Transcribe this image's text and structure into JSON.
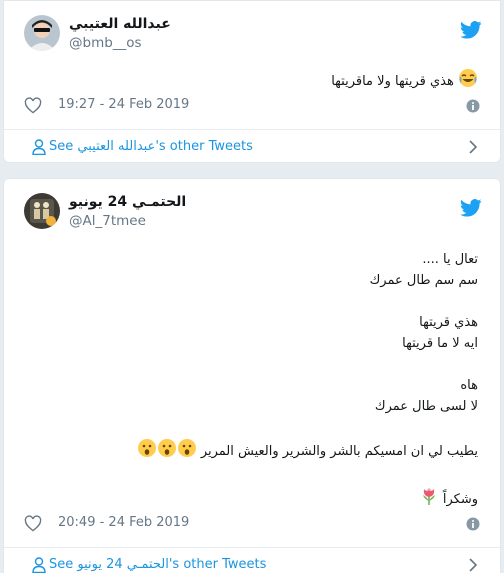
{
  "tweets": [
    {
      "author_name": "عبدالله العتيبي",
      "author_handle": "@bmb__os",
      "text_lines": [
        "هذي قريتها ولا ماقريتها"
      ],
      "emoji": "joy",
      "timestamp": "19:27 - 24 Feb 2019",
      "see_more": {
        "prefix": "See ",
        "name": "عبدالله العتيبي",
        "suffix": "'s other Tweets"
      }
    },
    {
      "author_name": "الحتمـي 24 يونيو",
      "author_handle": "@Al_7tmee",
      "text_lines": [
        "تعال يا ....",
        "سم سم طال عمرك",
        "",
        "هذي قريتها",
        "ايه لا ما قريتها",
        "",
        "هاه",
        "لا لسى طال عمرك",
        "",
        "يطيب لي ان امسيكم بالشر والشرير والعيش المرير",
        "",
        "وشكراً"
      ],
      "timestamp": "20:49 - 24 Feb 2019",
      "see_more": {
        "prefix": "See ",
        "name": "الحتمـي 24 يونيو",
        "suffix": "'s other Tweets"
      }
    }
  ],
  "colors": {
    "twitter_blue": "#1da1f2",
    "link_blue": "#1b95e0",
    "muted_gray": "#657786",
    "background": "#e6ecf0"
  },
  "icons": {
    "logo": "twitter-bird-icon",
    "like": "heart-icon",
    "info": "info-icon",
    "profile": "person-icon",
    "chevron": "chevron-right-icon"
  }
}
